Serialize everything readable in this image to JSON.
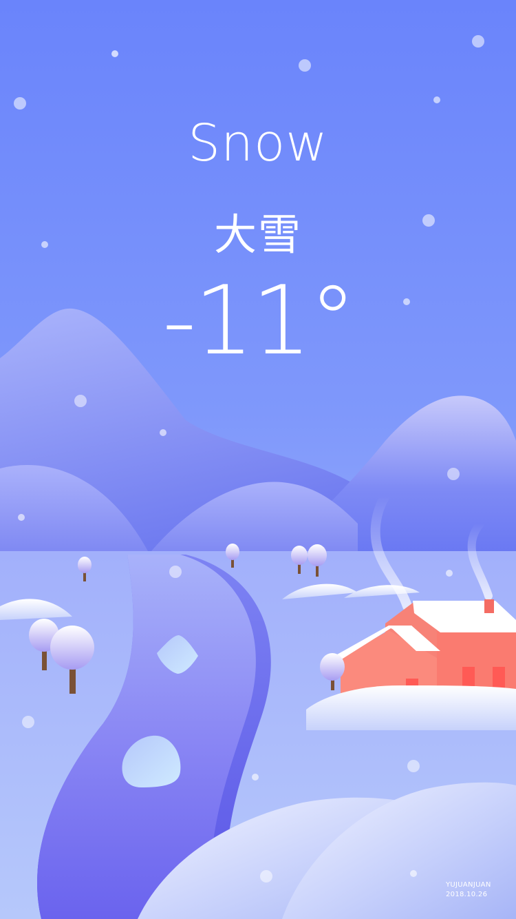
{
  "weather": {
    "condition_en": "Snow",
    "condition_zh": "大雪",
    "temperature": "-11°"
  },
  "signature": {
    "author": "YUJUANJUAN",
    "date": "2018.10.26"
  },
  "colors": {
    "sky_top": "#6b86fb",
    "sky_bottom": "#b4c6fb",
    "river": "#7b74f1",
    "snow": "#f4f6ff",
    "house": "#fa7f72",
    "roof": "#ffffff",
    "tree_trunk": "#7a5136"
  },
  "illustration": {
    "subject": "snowy-village-landscape",
    "elements": [
      "mountain",
      "hill",
      "river",
      "ice-floe",
      "tree",
      "house",
      "chimney-smoke",
      "snowflake"
    ]
  }
}
